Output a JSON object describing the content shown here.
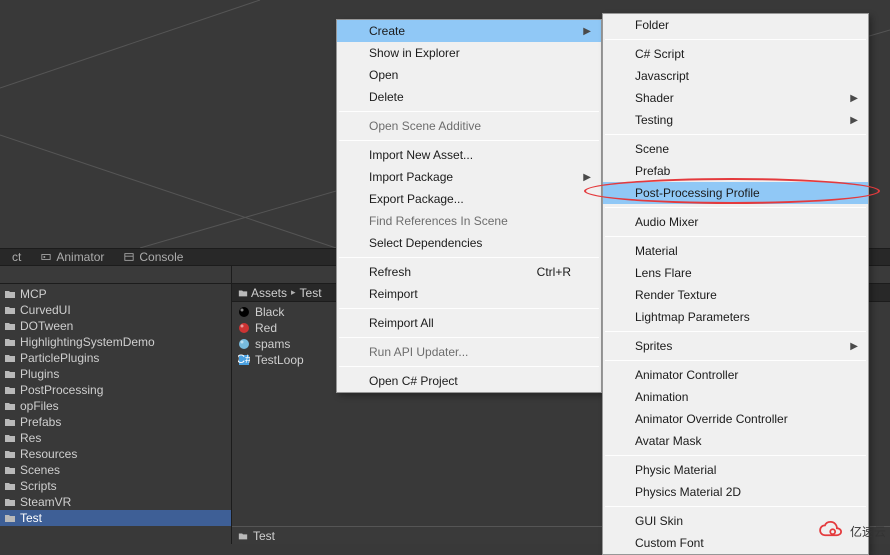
{
  "tabs": {
    "project_trunc": "ct",
    "animator": "Animator",
    "console": "Console"
  },
  "hierarchy": {
    "items": [
      {
        "icon": "folder",
        "label": "MCP"
      },
      {
        "icon": "folder",
        "label": "CurvedUI"
      },
      {
        "icon": "folder",
        "label": "DOTween"
      },
      {
        "icon": "folder",
        "label": "HighlightingSystemDemo"
      },
      {
        "icon": "folder",
        "label": "ParticlePlugins"
      },
      {
        "icon": "folder",
        "label": "Plugins"
      },
      {
        "icon": "folder",
        "label": "PostProcessing"
      },
      {
        "icon": "folder",
        "label": "opFiles"
      },
      {
        "icon": "folder",
        "label": "Prefabs"
      },
      {
        "icon": "folder",
        "label": "Res"
      },
      {
        "icon": "folder",
        "label": "Resources"
      },
      {
        "icon": "folder",
        "label": "Scenes"
      },
      {
        "icon": "folder",
        "label": "Scripts"
      },
      {
        "icon": "folder",
        "label": "SteamVR"
      },
      {
        "icon": "folder",
        "label": "Test",
        "selected": true
      }
    ]
  },
  "breadcrumb": {
    "root": "Assets",
    "folder": "Test"
  },
  "assets": [
    {
      "icon": "sphere",
      "color": "#000",
      "label": "Black"
    },
    {
      "icon": "sphere",
      "color": "#c33",
      "label": "Red"
    },
    {
      "icon": "sphere",
      "color": "#7bd",
      "label": "spams"
    },
    {
      "icon": "cs",
      "color": "#4aa0e0",
      "label": "TestLoop"
    }
  ],
  "status": {
    "label": "Test"
  },
  "contextMenu": [
    {
      "type": "item",
      "label": "Create",
      "submenu": true,
      "highlight": true
    },
    {
      "type": "item",
      "label": "Show in Explorer"
    },
    {
      "type": "item",
      "label": "Open"
    },
    {
      "type": "item",
      "label": "Delete"
    },
    {
      "type": "sep"
    },
    {
      "type": "item",
      "label": "Open Scene Additive",
      "disabled": true
    },
    {
      "type": "sep"
    },
    {
      "type": "item",
      "label": "Import New Asset..."
    },
    {
      "type": "item",
      "label": "Import Package",
      "submenu": true
    },
    {
      "type": "item",
      "label": "Export Package..."
    },
    {
      "type": "item",
      "label": "Find References In Scene",
      "disabled": true
    },
    {
      "type": "item",
      "label": "Select Dependencies"
    },
    {
      "type": "sep"
    },
    {
      "type": "item",
      "label": "Refresh",
      "shortcut": "Ctrl+R"
    },
    {
      "type": "item",
      "label": "Reimport"
    },
    {
      "type": "sep"
    },
    {
      "type": "item",
      "label": "Reimport All"
    },
    {
      "type": "sep"
    },
    {
      "type": "item",
      "label": "Run API Updater...",
      "disabled": true
    },
    {
      "type": "sep"
    },
    {
      "type": "item",
      "label": "Open C# Project"
    }
  ],
  "submenu": [
    {
      "type": "item",
      "label": "Folder"
    },
    {
      "type": "sep"
    },
    {
      "type": "item",
      "label": "C# Script"
    },
    {
      "type": "item",
      "label": "Javascript"
    },
    {
      "type": "item",
      "label": "Shader",
      "submenu": true
    },
    {
      "type": "item",
      "label": "Testing",
      "submenu": true
    },
    {
      "type": "sep"
    },
    {
      "type": "item",
      "label": "Scene"
    },
    {
      "type": "item",
      "label": "Prefab"
    },
    {
      "type": "item",
      "label": "Post-Processing Profile",
      "highlight": true
    },
    {
      "type": "sep"
    },
    {
      "type": "item",
      "label": "Audio Mixer"
    },
    {
      "type": "sep"
    },
    {
      "type": "item",
      "label": "Material"
    },
    {
      "type": "item",
      "label": "Lens Flare"
    },
    {
      "type": "item",
      "label": "Render Texture"
    },
    {
      "type": "item",
      "label": "Lightmap Parameters"
    },
    {
      "type": "sep"
    },
    {
      "type": "item",
      "label": "Sprites",
      "submenu": true
    },
    {
      "type": "sep"
    },
    {
      "type": "item",
      "label": "Animator Controller"
    },
    {
      "type": "item",
      "label": "Animation"
    },
    {
      "type": "item",
      "label": "Animator Override Controller"
    },
    {
      "type": "item",
      "label": "Avatar Mask"
    },
    {
      "type": "sep"
    },
    {
      "type": "item",
      "label": "Physic Material"
    },
    {
      "type": "item",
      "label": "Physics Material 2D"
    },
    {
      "type": "sep"
    },
    {
      "type": "item",
      "label": "GUI Skin"
    },
    {
      "type": "item",
      "label": "Custom Font"
    }
  ],
  "watermark": "亿速云"
}
